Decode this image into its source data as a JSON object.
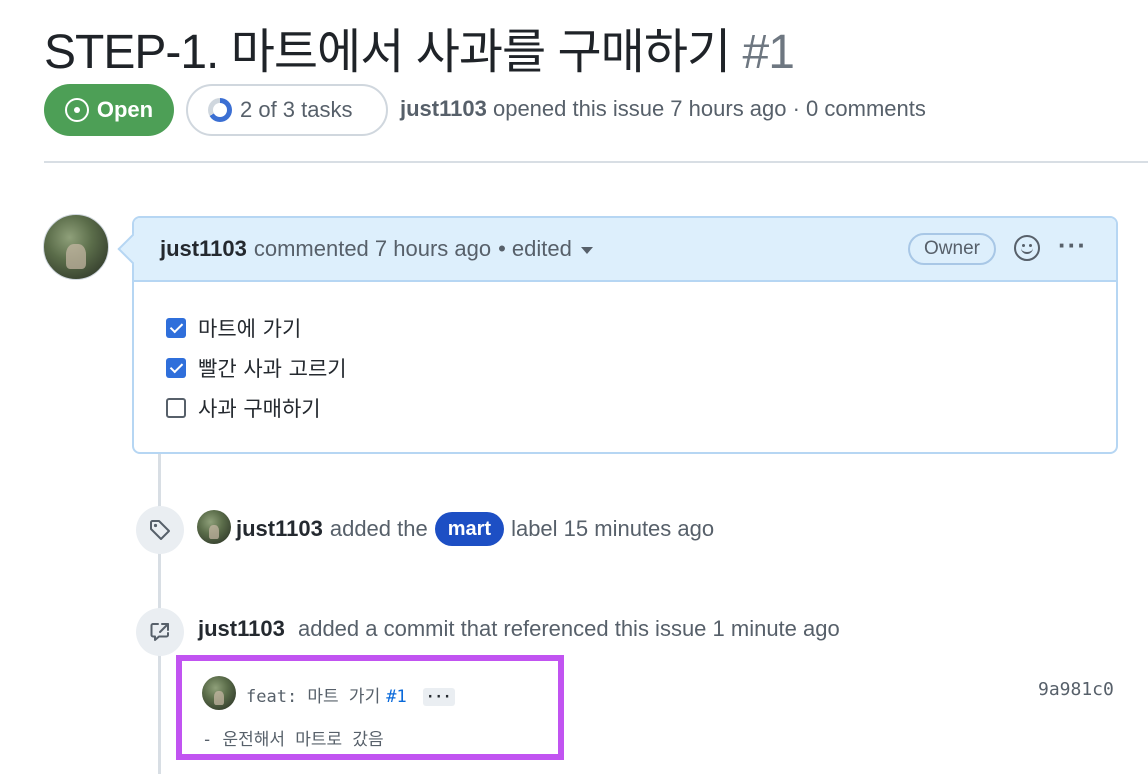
{
  "issue": {
    "title": "STEP-1. 마트에서 사과를 구매하기",
    "number": "#1",
    "state": "Open",
    "tasks_summary": "2 of 3 tasks",
    "tasks_progress": 0.667,
    "author": "just1103",
    "meta_text": "opened this issue 7 hours ago · 0 comments"
  },
  "comment": {
    "author": "just1103",
    "action": "commented 7 hours ago",
    "edited_label": "• edited",
    "owner_badge": "Owner",
    "tasks": [
      {
        "label": "마트에 가기",
        "checked": true
      },
      {
        "label": "빨간 사과 고르기",
        "checked": true
      },
      {
        "label": "사과 구매하기",
        "checked": false
      }
    ]
  },
  "events": [
    {
      "type": "label",
      "icon": "tag-icon",
      "author": "just1103",
      "text_before": "added the",
      "label_name": "mart",
      "label_color": "#1d4fc4",
      "text_after": "label 15 minutes ago"
    },
    {
      "type": "commit-reference",
      "icon": "cross-reference-icon",
      "author": "just1103",
      "text": "added a commit that referenced this issue 1 minute ago",
      "commit": {
        "message": "feat: 마트 가기",
        "issue_ref": "#1",
        "expand_label": "···",
        "body": "- 운전해서 마트로 갔음",
        "sha": "9a981c0"
      }
    }
  ],
  "colors": {
    "open_green": "#4d9f56",
    "highlight_purple": "#c154f1",
    "comment_header_bg": "#ddeffc"
  }
}
